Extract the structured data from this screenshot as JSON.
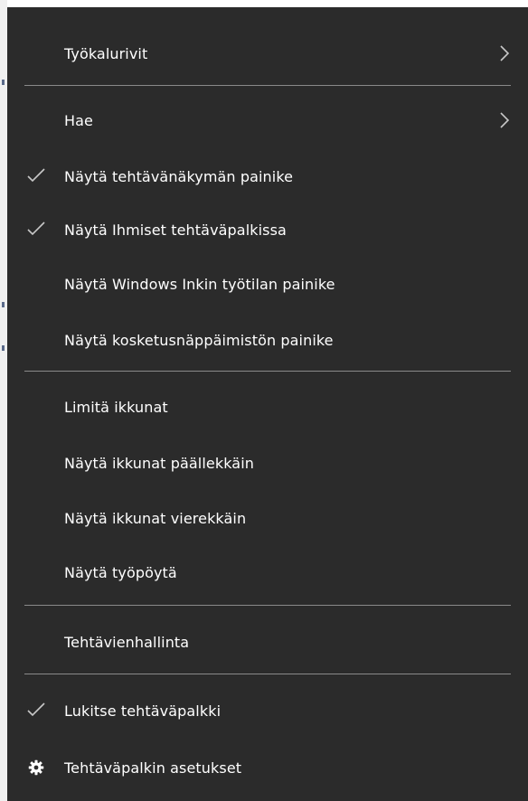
{
  "menu": {
    "items": [
      {
        "label": "Työkalurivit",
        "icon": "chevron-right-icon"
      },
      {
        "label": "Hae",
        "icon": "chevron-right-icon"
      },
      {
        "label": "Näytä tehtävänäkymän painike",
        "icon": "checkmark-icon"
      },
      {
        "label": "Näytä Ihmiset tehtäväpalkissa",
        "icon": "checkmark-icon"
      },
      {
        "label": "Näytä Windows Inkin työtilan painike"
      },
      {
        "label": "Näytä kosketusnäppäimistön painike"
      },
      {
        "label": "Limitä ikkunat"
      },
      {
        "label": "Näytä ikkunat päällekkäin"
      },
      {
        "label": "Näytä ikkunat vierekkäin"
      },
      {
        "label": "Näytä työpöytä"
      },
      {
        "label": "Tehtävienhallinta"
      },
      {
        "label": "Lukitse tehtäväpalkki",
        "icon": "checkmark-icon"
      },
      {
        "label": "Tehtäväpalkin asetukset",
        "icon": "gear-icon"
      }
    ]
  },
  "colors": {
    "background": "#2b2b2b",
    "text": "#ffffff",
    "separator": "#8a8a8a",
    "glyph": "#c8c8c8"
  }
}
